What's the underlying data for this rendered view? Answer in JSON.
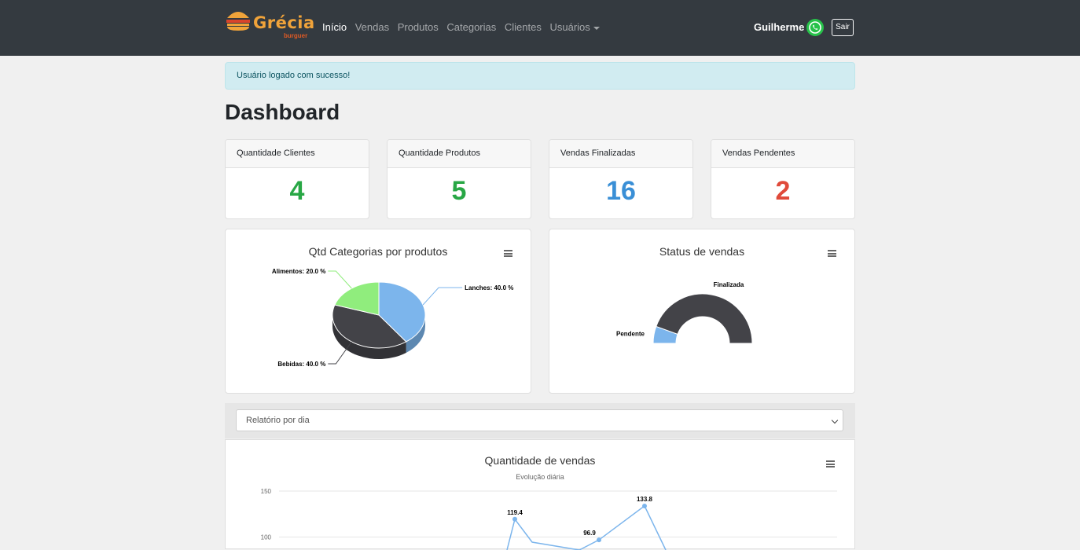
{
  "brand": {
    "name": "Grécia",
    "sub": "burguer"
  },
  "nav": {
    "items": [
      {
        "label": "Início",
        "active": true
      },
      {
        "label": "Vendas"
      },
      {
        "label": "Produtos"
      },
      {
        "label": "Categorias"
      },
      {
        "label": "Clientes"
      },
      {
        "label": "Usuários"
      }
    ],
    "user": "Guilherme",
    "logout": "Sair"
  },
  "alert": "Usuário logado com sucesso!",
  "page_title": "Dashboard",
  "stats": [
    {
      "label": "Quantidade Clientes",
      "value": "4",
      "color": "#28a745"
    },
    {
      "label": "Quantidade Produtos",
      "value": "5",
      "color": "#28a745"
    },
    {
      "label": "Vendas Finalizadas",
      "value": "16",
      "color": "#3a8fd6"
    },
    {
      "label": "Vendas Pendentes",
      "value": "2",
      "color": "#e04a3a"
    }
  ],
  "report_select": {
    "selected": "Relatório por dia"
  },
  "chart_data": [
    {
      "type": "pie",
      "title": "Qtd Categorias por produtos",
      "slices": [
        {
          "label": "Lanches: 40.0 %",
          "value": 40,
          "color": "#7cb5ec"
        },
        {
          "label": "Bebidas: 40.0 %",
          "value": 40,
          "color": "#434348"
        },
        {
          "label": "Alimentos: 20.0 %",
          "value": 20,
          "color": "#90ed7d"
        }
      ]
    },
    {
      "type": "pie",
      "title": "Status de vendas",
      "semicircle": true,
      "slices": [
        {
          "label": "Pendente",
          "value": 2,
          "color": "#7cb5ec"
        },
        {
          "label": "Finalizada",
          "value": 16,
          "color": "#434348"
        }
      ]
    },
    {
      "type": "line",
      "title": "Quantidade de vendas",
      "subtitle": "Evolução diária",
      "y_ticks": [
        "150",
        "100"
      ],
      "points": [
        {
          "label": "119.4",
          "value": 119.4
        },
        {
          "label": "96.9",
          "value": 96.9
        },
        {
          "label": "133.8",
          "value": 133.8
        }
      ],
      "color": "#7cb5ec"
    }
  ]
}
